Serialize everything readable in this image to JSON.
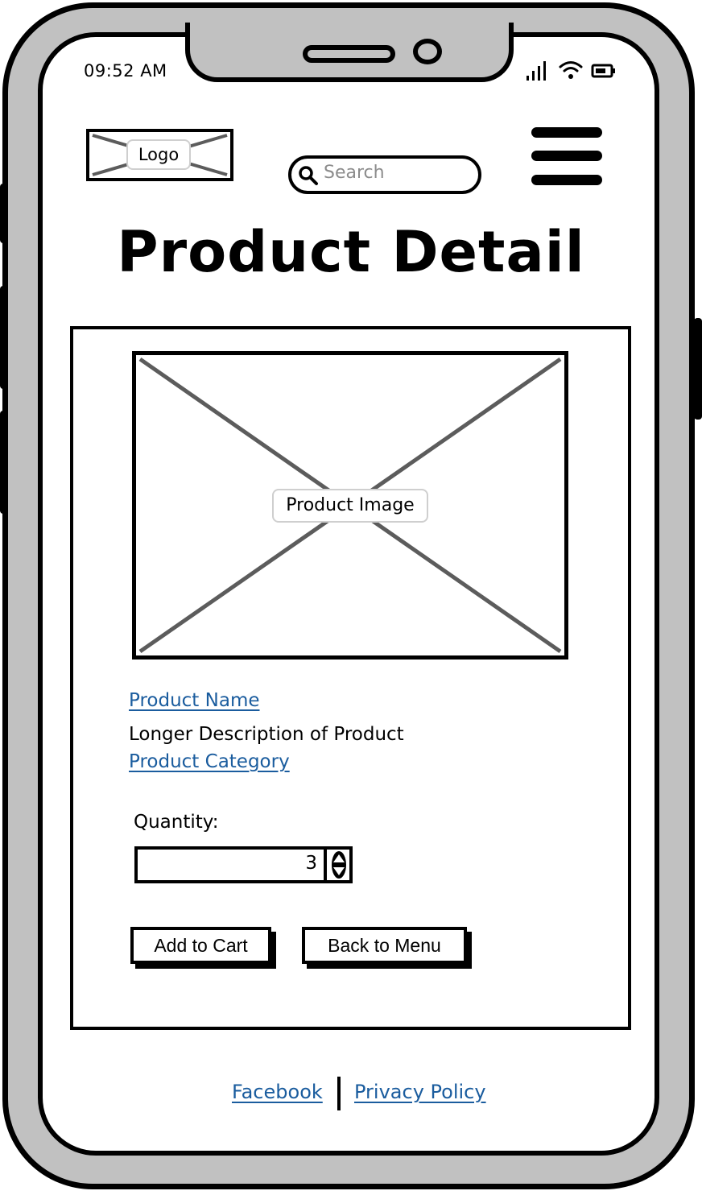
{
  "status_bar": {
    "time": "09:52 AM"
  },
  "header": {
    "logo_label": "Logo",
    "search_placeholder": "Search"
  },
  "page": {
    "title": "Product Detail"
  },
  "product": {
    "image_label": "Product Image",
    "name": "Product Name",
    "description": "Longer Description of Product",
    "category": "Product Category"
  },
  "quantity": {
    "label": "Quantity:",
    "value": "3"
  },
  "actions": {
    "add_to_cart": "Add to Cart",
    "back_to_menu": "Back to Menu"
  },
  "footer": {
    "facebook": "Facebook",
    "privacy_policy": "Privacy Policy"
  },
  "icons": {
    "search": "search-icon",
    "menu": "hamburger-menu-icon",
    "signal": "signal-icon",
    "wifi": "wifi-icon",
    "battery": "battery-icon"
  },
  "colors": {
    "link": "#1a5c9e",
    "frame_fill": "#c1c1c1",
    "placeholder": "#8c8c8c"
  }
}
